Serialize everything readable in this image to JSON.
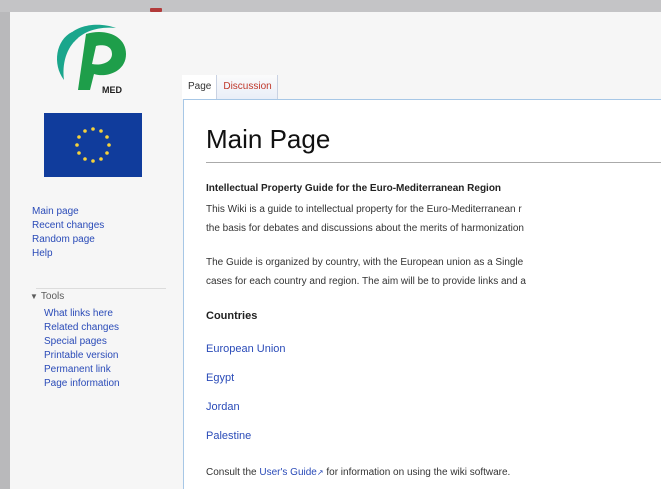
{
  "sidebar": {
    "logo_text": "MED",
    "nav": [
      "Main page",
      "Recent changes",
      "Random page",
      "Help"
    ],
    "tools_heading": "Tools",
    "tools": [
      "What links here",
      "Related changes",
      "Special pages",
      "Printable version",
      "Permanent link",
      "Page information"
    ]
  },
  "tabs": [
    "Page",
    "Discussion"
  ],
  "content": {
    "title": "Main Page",
    "subheading": "Intellectual Property Guide for the Euro-Mediterranean Region",
    "para1_line1": "This Wiki is a guide to intellectual property for the Euro-Mediterranean r",
    "para1_line2": "the basis for debates and discussions about the merits of harmonization",
    "para2_line1": "The Guide is organized by country, with the European union as a Single",
    "para2_line2": "cases for each country and region. The aim will be to provide links and a",
    "countries_heading": "Countries",
    "countries": [
      "European Union",
      "Egypt",
      "Jordan",
      "Palestine"
    ],
    "consult_before": "Consult the ",
    "consult_link": "User's Guide",
    "consult_after": " for information on using the wiki software."
  },
  "colors": {
    "link": "#2a4bb8",
    "logo_teal": "#1aa68c",
    "flag_blue": "#103c9c",
    "flag_star": "#f6d23a"
  }
}
